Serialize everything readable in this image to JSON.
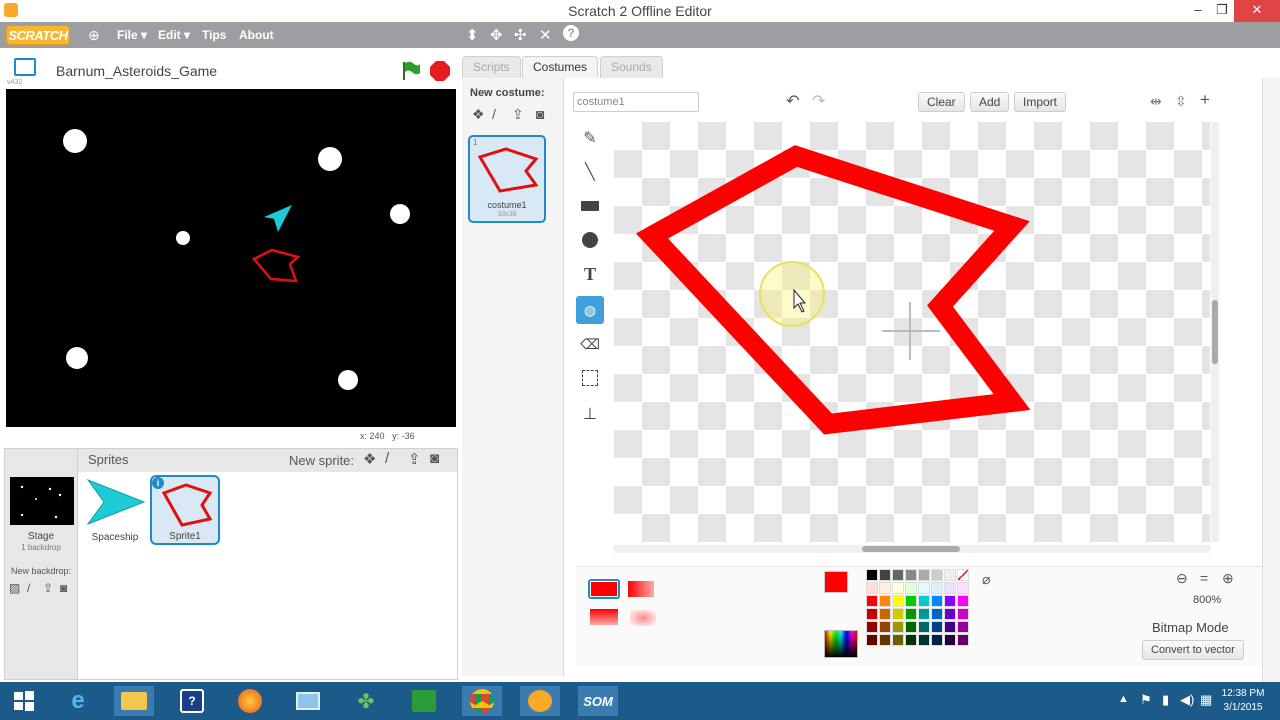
{
  "window": {
    "title": "Scratch 2 Offline Editor"
  },
  "menubar": {
    "logo": "SCRATCH",
    "items": [
      "File ▾",
      "Edit ▾",
      "Tips",
      "About"
    ]
  },
  "project": {
    "name": "Barnum_Asteroids_Game",
    "version": "v432"
  },
  "stage": {
    "coords_x_label": "x:",
    "coords_x": "240",
    "coords_y_label": "y:",
    "coords_y": "-36"
  },
  "sprites": {
    "header": "Sprites",
    "new_sprite_label": "New sprite:",
    "stage_label": "Stage",
    "stage_backdrops": "1 backdrop",
    "new_backdrop_label": "New backdrop:",
    "items": [
      {
        "name": "Spaceship"
      },
      {
        "name": "Sprite1"
      }
    ]
  },
  "tabs": [
    "Scripts",
    "Costumes",
    "Sounds"
  ],
  "costumes": {
    "new_costume_label": "New costume:",
    "item": {
      "number": "1",
      "name": "costume1",
      "size": "33x38"
    }
  },
  "editor": {
    "costume_name_value": "costume1",
    "clear_label": "Clear",
    "add_label": "Add",
    "import_label": "Import",
    "zoom": "800%",
    "mode_label": "Bitmap Mode",
    "convert_label": "Convert to vector",
    "primary_color": "#ff0000"
  },
  "taskbar": {
    "time": "12:38 PM",
    "date": "3/1/2015",
    "app_label": "SOM"
  }
}
